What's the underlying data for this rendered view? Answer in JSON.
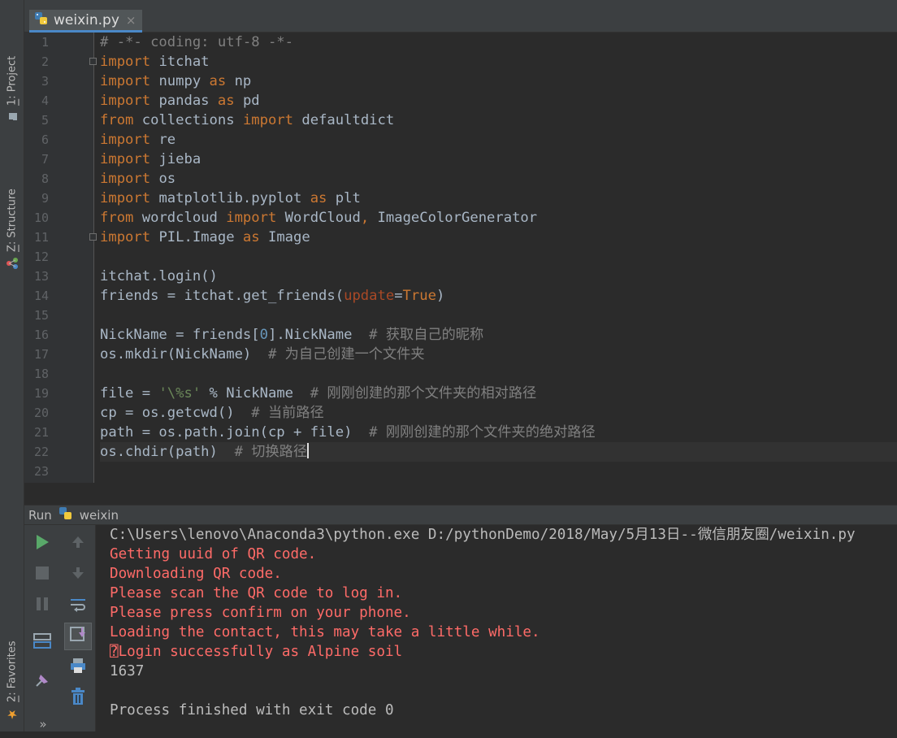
{
  "side_tabs": {
    "project": {
      "num": "1",
      "label": "Project"
    },
    "structure": {
      "num": "Z",
      "label": "Structure"
    },
    "favorites": {
      "num": "2",
      "label": "Favorites"
    }
  },
  "editor_tab": {
    "filename": "weixin.py",
    "close": "×"
  },
  "code_lines": [
    {
      "n": "1",
      "tokens": [
        {
          "c": "cm",
          "t": "# -*- coding: utf-8 -*-"
        }
      ]
    },
    {
      "n": "2",
      "tokens": [
        {
          "c": "kw",
          "t": "import"
        },
        {
          "c": "",
          "t": " itchat"
        }
      ]
    },
    {
      "n": "3",
      "tokens": [
        {
          "c": "kw",
          "t": "import"
        },
        {
          "c": "",
          "t": " numpy "
        },
        {
          "c": "kw",
          "t": "as"
        },
        {
          "c": "",
          "t": " np"
        }
      ]
    },
    {
      "n": "4",
      "tokens": [
        {
          "c": "kw",
          "t": "import"
        },
        {
          "c": "",
          "t": " pandas "
        },
        {
          "c": "kw",
          "t": "as"
        },
        {
          "c": "",
          "t": " pd"
        }
      ]
    },
    {
      "n": "5",
      "tokens": [
        {
          "c": "kw",
          "t": "from"
        },
        {
          "c": "",
          "t": " collections "
        },
        {
          "c": "kw",
          "t": "import"
        },
        {
          "c": "",
          "t": " defaultdict"
        }
      ]
    },
    {
      "n": "6",
      "tokens": [
        {
          "c": "kw",
          "t": "import"
        },
        {
          "c": "",
          "t": " re"
        }
      ]
    },
    {
      "n": "7",
      "tokens": [
        {
          "c": "kw",
          "t": "import"
        },
        {
          "c": "",
          "t": " jieba"
        }
      ]
    },
    {
      "n": "8",
      "tokens": [
        {
          "c": "kw",
          "t": "import"
        },
        {
          "c": "",
          "t": " os"
        }
      ]
    },
    {
      "n": "9",
      "tokens": [
        {
          "c": "kw",
          "t": "import"
        },
        {
          "c": "",
          "t": " matplotlib.pyplot "
        },
        {
          "c": "kw",
          "t": "as"
        },
        {
          "c": "",
          "t": " plt"
        }
      ]
    },
    {
      "n": "10",
      "tokens": [
        {
          "c": "kw",
          "t": "from"
        },
        {
          "c": "",
          "t": " wordcloud "
        },
        {
          "c": "kw",
          "t": "import"
        },
        {
          "c": "",
          "t": " WordCloud"
        },
        {
          "c": "kw",
          "t": ","
        },
        {
          "c": "",
          "t": " ImageColorGenerator"
        }
      ]
    },
    {
      "n": "11",
      "tokens": [
        {
          "c": "kw",
          "t": "import"
        },
        {
          "c": "",
          "t": " PIL.Image "
        },
        {
          "c": "kw",
          "t": "as"
        },
        {
          "c": "",
          "t": " Image"
        }
      ]
    },
    {
      "n": "12",
      "tokens": []
    },
    {
      "n": "13",
      "tokens": [
        {
          "c": "",
          "t": "itchat.login()"
        }
      ]
    },
    {
      "n": "14",
      "tokens": [
        {
          "c": "",
          "t": "friends = itchat.get_friends("
        },
        {
          "c": "pa",
          "t": "update"
        },
        {
          "c": "",
          "t": "="
        },
        {
          "c": "kw",
          "t": "True"
        },
        {
          "c": "",
          "t": ")"
        }
      ]
    },
    {
      "n": "15",
      "tokens": []
    },
    {
      "n": "16",
      "tokens": [
        {
          "c": "",
          "t": "NickName = friends["
        },
        {
          "c": "nu",
          "t": "0"
        },
        {
          "c": "",
          "t": "].NickName  "
        },
        {
          "c": "cm",
          "t": "# 获取自己的昵称"
        }
      ]
    },
    {
      "n": "17",
      "tokens": [
        {
          "c": "",
          "t": "os.mkdir(NickName)  "
        },
        {
          "c": "cm",
          "t": "# 为自己创建一个文件夹"
        }
      ]
    },
    {
      "n": "18",
      "tokens": []
    },
    {
      "n": "19",
      "tokens": [
        {
          "c": "",
          "t": "file = "
        },
        {
          "c": "st",
          "t": "'\\%s'"
        },
        {
          "c": "",
          "t": " % NickName  "
        },
        {
          "c": "cm",
          "t": "# 刚刚创建的那个文件夹的相对路径"
        }
      ]
    },
    {
      "n": "20",
      "tokens": [
        {
          "c": "",
          "t": "cp = os.getcwd()  "
        },
        {
          "c": "cm",
          "t": "# 当前路径"
        }
      ]
    },
    {
      "n": "21",
      "tokens": [
        {
          "c": "",
          "t": "path = os.path.join(cp + file)  "
        },
        {
          "c": "cm",
          "t": "# 刚刚创建的那个文件夹的绝对路径"
        }
      ]
    },
    {
      "n": "22",
      "tokens": [
        {
          "c": "",
          "t": "os.chdir(path)  "
        },
        {
          "c": "cm",
          "t": "# 切换路径"
        }
      ]
    },
    {
      "n": "23",
      "tokens": []
    }
  ],
  "run": {
    "label": "Run",
    "config": "weixin"
  },
  "console_lines": [
    {
      "kind": "std",
      "text": "C:\\Users\\lenovo\\Anaconda3\\python.exe D:/pythonDemo/2018/May/5月13日--微信朋友圈/weixin.py"
    },
    {
      "kind": "err",
      "text": "Getting uuid of QR code."
    },
    {
      "kind": "err",
      "text": "Downloading QR code."
    },
    {
      "kind": "err",
      "text": "Please scan the QR code to log in."
    },
    {
      "kind": "err",
      "text": "Please press confirm on your phone."
    },
    {
      "kind": "err",
      "text": "Loading the contact, this may take a little while."
    },
    {
      "kind": "err",
      "text": "⍰Login successfully as Alpine soil"
    },
    {
      "kind": "std",
      "text": "1637"
    },
    {
      "kind": "std",
      "text": ""
    },
    {
      "kind": "std",
      "text": "Process finished with exit code 0"
    }
  ],
  "colors": {
    "keyword": "#cc7832",
    "comment": "#808080",
    "string": "#6a8759",
    "number": "#6897bb",
    "param": "#aa4926",
    "error_text": "#ff6b68",
    "tab_underline": "#4a88c7"
  }
}
